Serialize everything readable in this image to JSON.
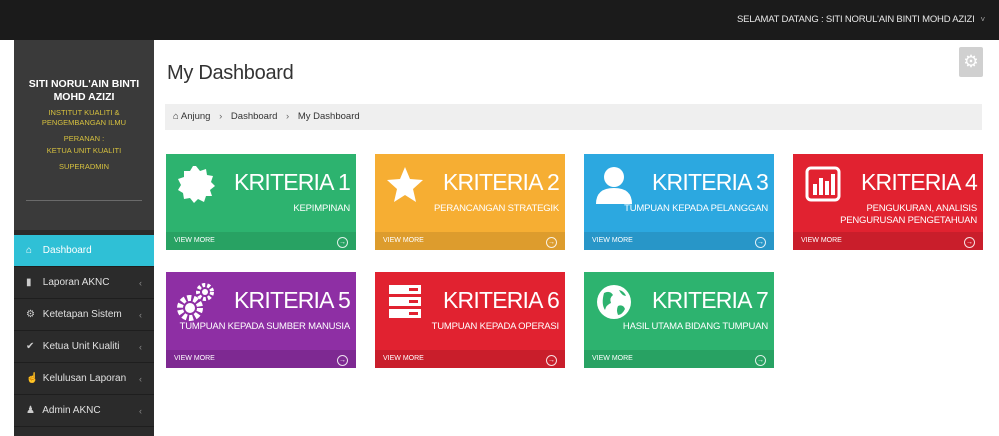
{
  "topbar": {
    "greeting": "SELAMAT DATANG : SITI NORUL'AIN BINTI MOHD AZIZI",
    "chevron": "˅"
  },
  "profile": {
    "name_line1": "SITI NORUL'AIN BINTI",
    "name_line2": "MOHD AZIZI",
    "org_line1": "INSTITUT KUALITI &",
    "org_line2": "PENGEMBANGAN ILMU",
    "role_label": "PERANAN :",
    "role": "KETUA UNIT KUALITI",
    "level": "SUPERADMIN"
  },
  "sidebar": {
    "items": [
      {
        "label": "Dashboard",
        "icon": "home-icon",
        "glyph": "⌂",
        "active": true
      },
      {
        "label": "Laporan AKNC",
        "icon": "file-icon",
        "glyph": "▮",
        "arrow": "‹"
      },
      {
        "label": "Ketetapan Sistem",
        "icon": "cogs-icon",
        "glyph": "⚙",
        "arrow": "‹"
      },
      {
        "label": "Ketua Unit Kualiti",
        "icon": "check-icon",
        "glyph": "✔",
        "arrow": "‹"
      },
      {
        "label": "Kelulusan Laporan",
        "icon": "thumbs-up-icon",
        "glyph": "☝",
        "arrow": "‹"
      },
      {
        "label": "Admin AKNC",
        "icon": "user-icon",
        "glyph": "♟",
        "arrow": "‹"
      }
    ]
  },
  "page": {
    "title": "My Dashboard",
    "settings_glyph": "⚙"
  },
  "breadcrumb": {
    "home_glyph": "⌂",
    "home": "Anjung",
    "sep": "›",
    "level1": "Dashboard",
    "level2": "My Dashboard"
  },
  "tiles": [
    {
      "title": "KRITERIA 1",
      "desc": "KEPIMPINAN",
      "desc2": "",
      "more": "VIEW MORE",
      "go": "→",
      "color": "#2db36f",
      "footer": "#28a263",
      "icon": "badge-icon"
    },
    {
      "title": "KRITERIA 2",
      "desc": "PERANCANGAN STRATEGIK",
      "desc2": "",
      "more": "VIEW MORE",
      "go": "→",
      "color": "#f6ae33",
      "footer": "#dd9c2d",
      "icon": "star-icon"
    },
    {
      "title": "KRITERIA 3",
      "desc": "TUMPUAN KEPADA PELANGGAN",
      "desc2": "",
      "more": "VIEW MORE",
      "go": "→",
      "color": "#2ca8e0",
      "footer": "#2896c8",
      "icon": "user-icon"
    },
    {
      "title": "KRITERIA 4",
      "desc": "PENGUKURAN, ANALISIS",
      "desc2": "PENGURUSAN PENGETAHUAN",
      "more": "VIEW MORE",
      "go": "→",
      "color": "#e12230",
      "footer": "#c91e2b",
      "icon": "bar-chart-icon"
    },
    {
      "title": "KRITERIA 5",
      "desc": "TUMPUAN KEPADA SUMBER MANUSIA",
      "desc2": "",
      "more": "VIEW MORE",
      "go": "→",
      "color": "#8e2fa4",
      "footer": "#7e2992",
      "icon": "cogs-icon"
    },
    {
      "title": "KRITERIA 6",
      "desc": "TUMPUAN KEPADA OPERASI",
      "desc2": "",
      "more": "VIEW MORE",
      "go": "→",
      "color": "#e12230",
      "footer": "#c91e2b",
      "icon": "server-icon"
    },
    {
      "title": "KRITERIA 7",
      "desc": "HASIL UTAMA BIDANG TUMPUAN",
      "desc2": "",
      "more": "VIEW MORE",
      "go": "→",
      "color": "#2db36f",
      "footer": "#28a263",
      "icon": "globe-icon"
    }
  ]
}
